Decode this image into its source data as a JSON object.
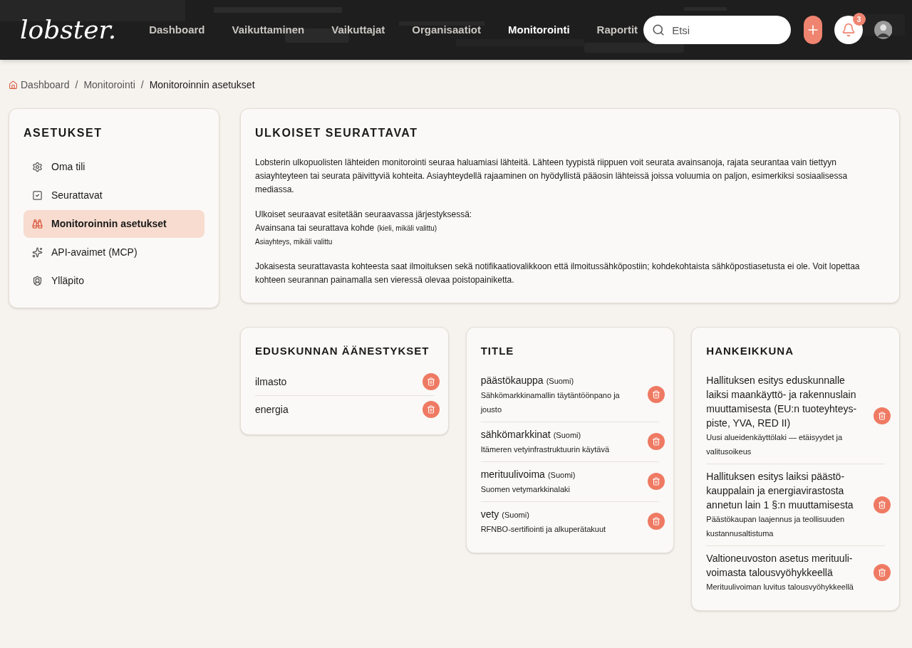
{
  "header": {
    "logo": "lobster.",
    "nav": [
      {
        "label": "Dashboard",
        "selected": false
      },
      {
        "label": "Vaikuttaminen",
        "selected": false
      },
      {
        "label": "Vaikuttajat",
        "selected": false
      },
      {
        "label": "Organisaatiot",
        "selected": false
      },
      {
        "label": "Monitorointi",
        "selected": true
      },
      {
        "label": "Raportit",
        "selected": false
      }
    ],
    "search": {
      "placeholder": "Etsi"
    },
    "notifications": {
      "count": "3"
    }
  },
  "breadcrumb": [
    {
      "kind": "link",
      "label": "Dashboard"
    },
    {
      "kind": "separator",
      "label": "/"
    },
    {
      "kind": "link",
      "label": "Monitorointi"
    },
    {
      "kind": "separator",
      "label": "/"
    },
    {
      "kind": "current",
      "label": "Monitoroinnin asetukset"
    }
  ],
  "sidebar": {
    "title": "ASETUKSET",
    "items": [
      {
        "label": "Oma tili",
        "selected": false
      },
      {
        "label": "Seurattavat",
        "selected": false
      },
      {
        "label": "Monitoroinnin asetukset",
        "selected": true
      },
      {
        "label": "API-avaimet (MCP)",
        "selected": false
      },
      {
        "label": "Ylläpito",
        "selected": false
      }
    ]
  },
  "intro": {
    "title": "ULKOISET SEURATTAVAT",
    "paragraph_1": "Lobsterin ulkopuolisten lähteiden monitorointi seuraa haluamiasi lähteitä. Lähteen tyypistä riippuen voit seurata avainsanoja, rajata seurantaa vain tiettyyn asiayhteyteen tai seurata päivittyviä kohteita. Asiayhteydellä rajaaminen on hyödyllistä pääosin lähteissä joissa voluumia on paljon, esimerkiksi sosiaalisessa mediassa.",
    "order_heading": "Ulkoiset seuraavat esitetään seuraavassa järjestyksessä:",
    "order_line_1": "Avainsana tai seurattava kohde",
    "order_line_1_note": "(kieli, mikäli valittu)",
    "order_line_2": "Asiayhteys, mikäli valittu",
    "paragraph_2": "Jokaisesta seurattavasta kohteesta saat ilmoituksen sekä notifikaatiovalikkoon että ilmoitussähköpostiin; kohdekohtaista sähköpostiasetusta ei ole. Voit lopettaa kohteen seurannan painamalla sen vieressä olevaa poistopainiketta."
  },
  "sources": [
    {
      "title": "EDUSKUNNAN ÄÄNESTYKSET",
      "items": [
        {
          "title": "ilmasto"
        },
        {
          "title": "energia"
        }
      ]
    },
    {
      "title": "TITLE",
      "items": [
        {
          "title": "päästökauppa",
          "language": "(Suomi)",
          "subtitle": "Sähkömarkkinamallin täytäntöönpano ja jousto"
        },
        {
          "title": "sähkömarkkinat",
          "language": "(Suomi)",
          "subtitle": "Itämeren vetyinfrastruktuurin käytävä"
        },
        {
          "title": "merituulivoima",
          "language": "(Suomi)",
          "subtitle": "Suomen vetymarkkinalaki"
        },
        {
          "title": "vety",
          "language": "(Suomi)",
          "subtitle": "RFNBO-sertifiointi ja alkuperätakuut"
        }
      ]
    },
    {
      "title": "HANKEIKKUNA",
      "items": [
        {
          "title": "Hallituksen esitys eduskunnalle laiksi maankäyttö- ja rakennuslain muuttamisesta (EU:n tuoteyhteys-piste, YVA, RED II)",
          "subtitle": "Uusi alueidenkäyttölaki — etäisyydet ja valitusoikeus"
        },
        {
          "title": "Hallituksen esitys laiksi päästö-kauppalain ja energiavirastosta annetun lain 1 §:n muuttamisesta",
          "subtitle": "Päästökaupan laajennus ja teollisuuden kustannusaltistuma"
        },
        {
          "title": "Valtioneuvoston asetus merituuli-voimasta talousvyöhykkeellä",
          "subtitle": "Merituulivoiman luvitus talousvyöhykkeellä"
        }
      ]
    }
  ]
}
